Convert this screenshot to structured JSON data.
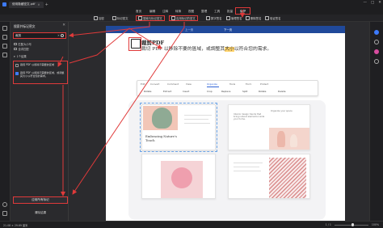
{
  "window": {
    "tab_title": "使用隐藏密文.pdf",
    "new_tab": "+",
    "controls": [
      "—",
      "□",
      "✕"
    ]
  },
  "menu": {
    "items": [
      {
        "label": "首页"
      },
      {
        "label": "编辑"
      },
      {
        "label": "注释"
      },
      {
        "label": "转换"
      },
      {
        "label": "视图"
      },
      {
        "label": "整理"
      },
      {
        "label": "工具"
      },
      {
        "label": "批量"
      },
      {
        "label": "保护"
      }
    ],
    "active_index": 8
  },
  "toolbar": {
    "items": [
      {
        "label": "加密",
        "boxed": false
      },
      {
        "label": "标记密文",
        "boxed": false
      },
      {
        "label": "搜索与标记密文",
        "boxed": true
      },
      {
        "label": "应用标记的密文",
        "boxed": true
      },
      {
        "label": "数字签名",
        "boxed": false
      },
      {
        "label": "管理签名",
        "boxed": false
      },
      {
        "label": "删除签名",
        "boxed": false
      },
      {
        "label": "验证签名",
        "boxed": false
      }
    ]
  },
  "panel": {
    "title": "搜索并标记密文",
    "close": "✕",
    "search_value": "裁剪",
    "search_clear": "✕",
    "options": [
      {
        "label": "匹配大小写"
      },
      {
        "label": "全词匹配"
      }
    ],
    "result_group": "1个结果",
    "results": [
      {
        "text": "裁剪 PDF 以移除不需要的区域",
        "checked": false
      },
      {
        "text": "裁剪 PDF 以移除不需要的区域，或调整其大小以符合您的需求。",
        "checked": true
      }
    ],
    "apply_button": "应用所有标记",
    "clear_button": "清除结果"
  },
  "document": {
    "header_tabs": [
      {
        "label": "上一页"
      },
      {
        "label": "下一页"
      }
    ],
    "title": "裁剪PDF",
    "body_before": "裁切 PDF 以移除不要的區域，或調整其",
    "highlight": "大小",
    "body_after": "以符合您的需求。",
    "strip_tabs": [
      {
        "label": "Edit"
      },
      {
        "label": "Convert"
      },
      {
        "label": "Comment"
      },
      {
        "label": "View"
      },
      {
        "label": "Organize"
      },
      {
        "label": "Tools"
      },
      {
        "label": "Form"
      },
      {
        "label": "Protect"
      }
    ],
    "strip_active_index": 4,
    "strip_tools": [
      {
        "label": "Rotate"
      },
      {
        "label": "Extract"
      },
      {
        "label": "Insert"
      },
      {
        "label": "Crop"
      },
      {
        "label": "Replace"
      },
      {
        "label": "Split"
      },
      {
        "label": "Rotate"
      },
      {
        "label": "Delete"
      }
    ],
    "mock_pages": {
      "page2_heading": "Organize your space",
      "page3_title": "Embracing Nature's Touch",
      "page3_small": "Interior design trends that bring natural elements inside your home."
    }
  },
  "status": {
    "page_size": "21.08 × 29.69 厘米",
    "page_nav": "1 / 1",
    "zoom": "100%"
  },
  "colors": {
    "accent": "#3d7bff",
    "annotation_red": "#e03a3a",
    "doc_header_blue": "#20499a",
    "highlight_yellow": "#ffd36b"
  }
}
